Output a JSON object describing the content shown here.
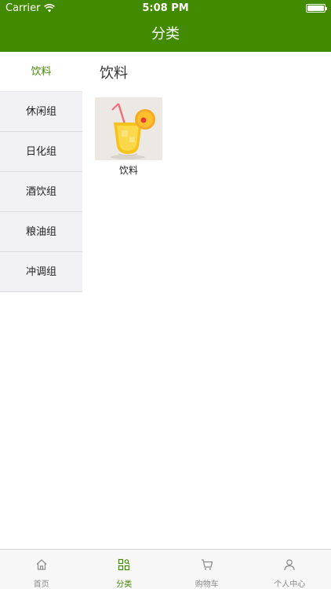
{
  "status_bar": {
    "carrier": "Carrier",
    "time": "5:08 PM"
  },
  "nav": {
    "title": "分类"
  },
  "sidebar": {
    "items": [
      {
        "label": "饮料"
      },
      {
        "label": "休闲组"
      },
      {
        "label": "日化组"
      },
      {
        "label": "酒饮组"
      },
      {
        "label": "粮油组"
      },
      {
        "label": "冲调组"
      }
    ],
    "selected": "饮料"
  },
  "content": {
    "section_title": "饮料",
    "products": [
      {
        "name": "饮料"
      }
    ]
  },
  "tabbar": {
    "tabs": [
      {
        "label": "首页",
        "icon": "home-icon"
      },
      {
        "label": "分类",
        "icon": "category-icon"
      },
      {
        "label": "购物车",
        "icon": "cart-icon"
      },
      {
        "label": "个人中心",
        "icon": "user-icon"
      }
    ],
    "active": "分类"
  },
  "colors": {
    "brand": "#428a00",
    "sidebar_bg": "#f2f2f4",
    "tab_inactive": "#8a8a8a"
  }
}
